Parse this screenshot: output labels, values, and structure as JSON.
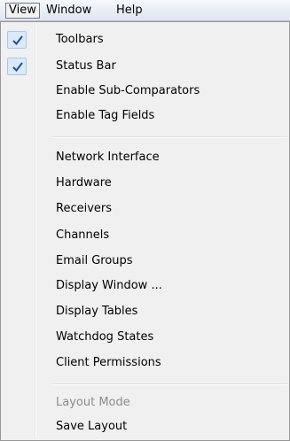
{
  "menubar": {
    "items": [
      {
        "label": "View",
        "active": true
      },
      {
        "label": "Window"
      },
      {
        "label": "Help"
      }
    ]
  },
  "view_menu": {
    "groups": [
      [
        {
          "label": "Toolbars",
          "checked": true
        },
        {
          "label": "Status Bar",
          "checked": true
        },
        {
          "label": "Enable Sub-Comparators"
        },
        {
          "label": "Enable Tag Fields"
        }
      ],
      [
        {
          "label": "Network Interface"
        },
        {
          "label": "Hardware"
        },
        {
          "label": "Receivers"
        },
        {
          "label": "Channels"
        },
        {
          "label": "Email Groups"
        },
        {
          "label": "Display Window ..."
        },
        {
          "label": "Display Tables"
        },
        {
          "label": "Watchdog States"
        },
        {
          "label": "Client Permissions"
        }
      ],
      [
        {
          "label": "Layout Mode",
          "disabled": true
        },
        {
          "label": "Save Layout"
        }
      ]
    ]
  },
  "colors": {
    "menu_bg": "#f0f0f0",
    "check_bg": "#dbe9f8",
    "check_border": "#a8c8ec",
    "check_mark": "#1f4e9c",
    "disabled_text": "#8d8d8d"
  },
  "icons": {
    "check": "check-icon"
  }
}
